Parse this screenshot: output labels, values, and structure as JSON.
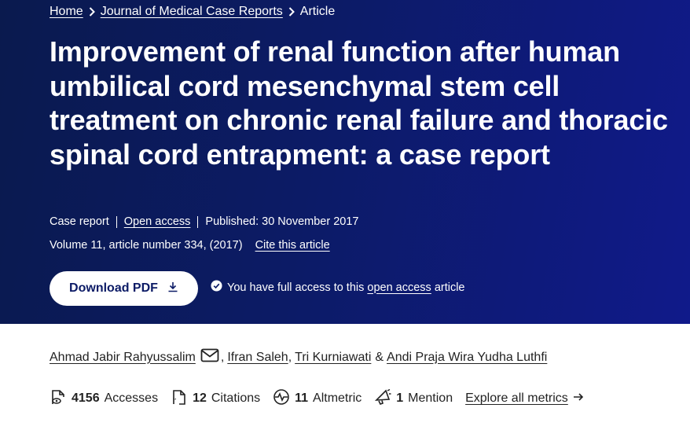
{
  "breadcrumb": {
    "home": "Home",
    "journal": "Journal of Medical Case Reports",
    "current": "Article"
  },
  "article": {
    "title": "Improvement of renal function after human umbilical cord mesenchymal stem cell treatment on chronic renal failure and thoracic spinal cord entrapment: a case report",
    "type": "Case report",
    "access": "Open access",
    "published": "Published: 30 November 2017",
    "volume": "Volume 11, article number 334, (2017)",
    "cite": "Cite this article"
  },
  "actions": {
    "download_label": "Download PDF",
    "access_prefix": "You have full access to this",
    "access_link": "open access",
    "access_suffix": "article"
  },
  "authors": [
    {
      "name": "Ahmad Jabir Rahyussalim",
      "sep": ""
    },
    {
      "name": "Ifran Saleh",
      "sep": ","
    },
    {
      "name": "Tri Kurniawati",
      "sep": ","
    },
    {
      "name": "Andi Praja Wira Yudha Luthfi",
      "sep": "&"
    }
  ],
  "metrics": {
    "accesses": {
      "value": "4156",
      "label": "Accesses"
    },
    "citations": {
      "value": "12",
      "label": "Citations"
    },
    "altmetric": {
      "value": "11",
      "label": "Altmetric"
    },
    "mentions": {
      "value": "1",
      "label": "Mention"
    },
    "explore": "Explore all metrics"
  },
  "colors": {
    "hero_bg_start": "#0a1a4e",
    "hero_bg_end": "#101a8a",
    "button_text": "#0c1b66"
  }
}
